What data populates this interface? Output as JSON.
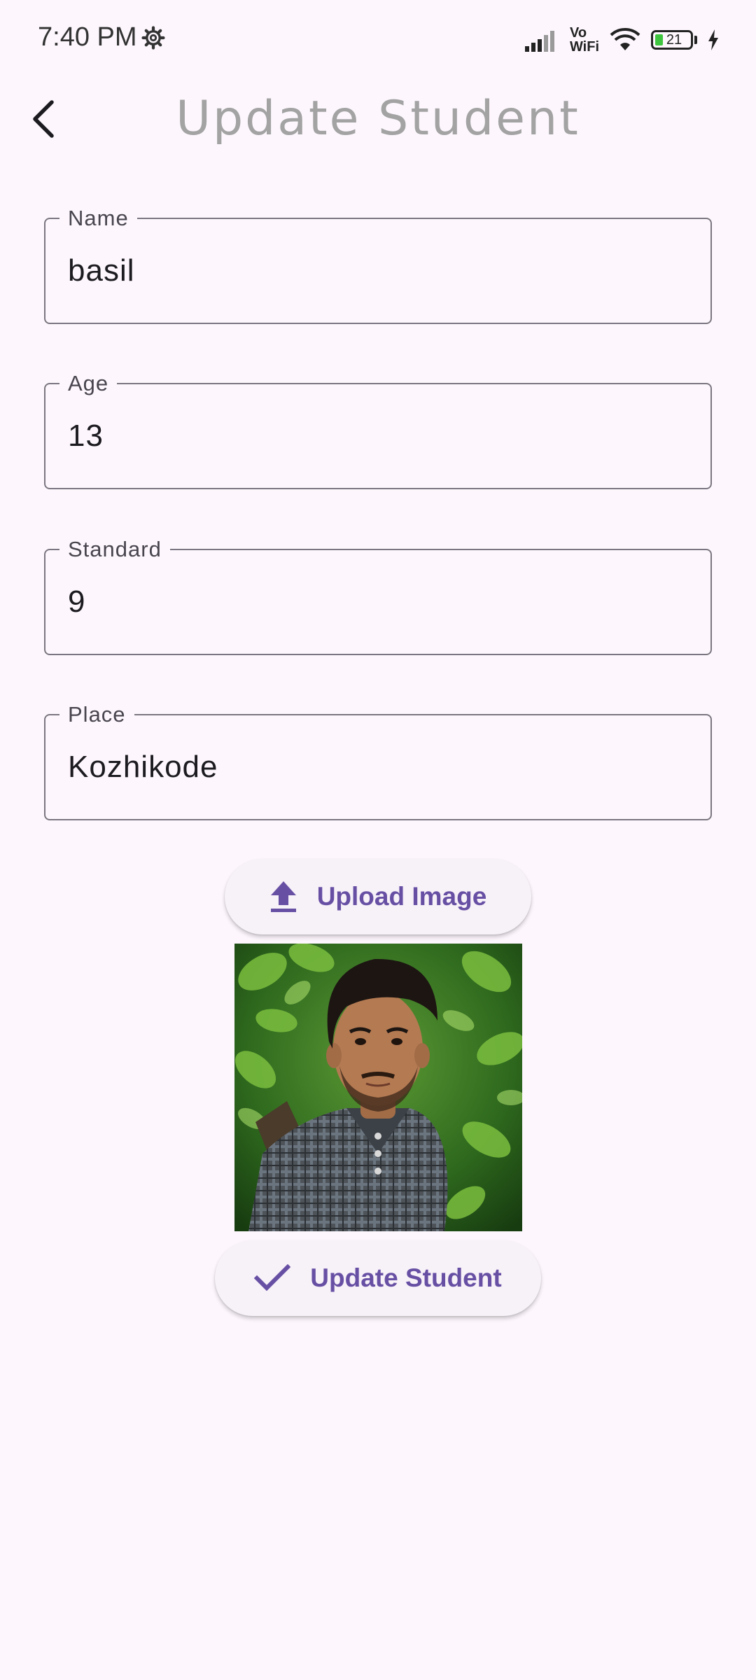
{
  "status_bar": {
    "time": "7:40 PM",
    "vowifi_top": "Vo",
    "vowifi_bottom": "WiFi",
    "battery": "21"
  },
  "app_bar": {
    "title": "Update Student"
  },
  "form": {
    "name": {
      "label": "Name",
      "value": "basil"
    },
    "age": {
      "label": "Age",
      "value": "13"
    },
    "standard": {
      "label": "Standard",
      "value": "9"
    },
    "place": {
      "label": "Place",
      "value": "Kozhikode"
    }
  },
  "upload_button": {
    "label": "Upload Image",
    "icon": "upload-icon"
  },
  "update_button": {
    "label": "Update Student",
    "icon": "check-icon"
  },
  "colors": {
    "background": "#fdf7fd",
    "accent": "#6750a4",
    "title": "#a3a3a3"
  }
}
